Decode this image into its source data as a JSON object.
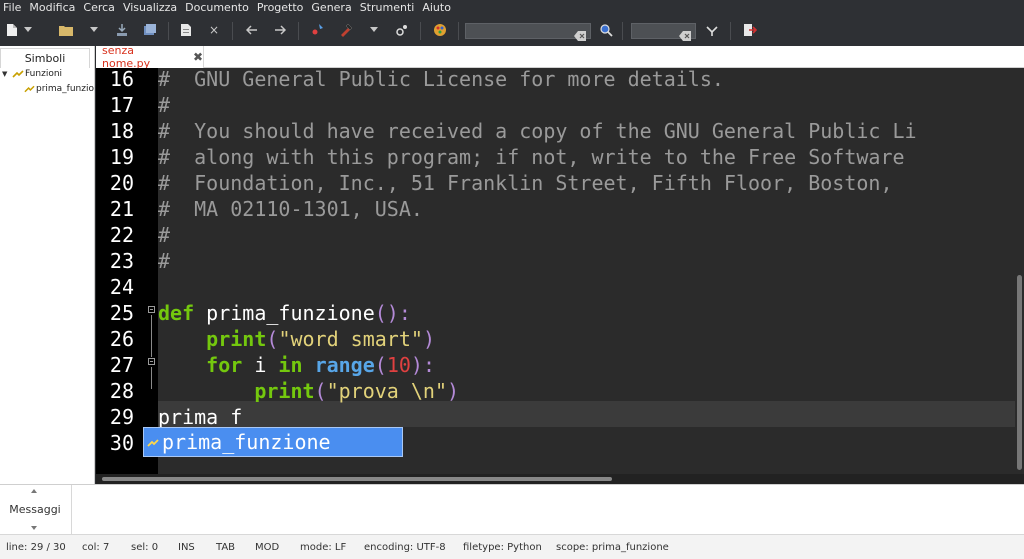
{
  "menubar": {
    "items": [
      "File",
      "Modifica",
      "Cerca",
      "Visualizza",
      "Documento",
      "Progetto",
      "Genera",
      "Strumenti",
      "Aiuto"
    ]
  },
  "toolbar": {
    "icons": [
      "new-file-icon",
      "dropdown-arrow-icon",
      "open-folder-icon",
      "dropdown-arrow-icon",
      "save-icon",
      "save-all-icon",
      "revert-icon",
      "close-icon",
      "back-icon",
      "forward-icon",
      "compile-icon",
      "build-icon",
      "dropdown-arrow-icon",
      "execute-icon",
      "color-picker-icon",
      "search-go-icon",
      "jump-to-line-icon",
      "quit-icon"
    ],
    "search_value": "",
    "goto_value": ""
  },
  "sidebar": {
    "tab_label": "Simboli",
    "tree": [
      {
        "label": "Funzioni",
        "level": 0,
        "expanded": true
      },
      {
        "label": "prima_funzio",
        "level": 1,
        "expanded": false
      }
    ]
  },
  "tabs": [
    {
      "title": "senza nome.py",
      "modified": true
    }
  ],
  "editor": {
    "lines": [
      {
        "n": "16",
        "tokens": [
          {
            "t": "cm",
            "v": "#  GNU General Public License for more details."
          }
        ]
      },
      {
        "n": "17",
        "tokens": [
          {
            "t": "cm",
            "v": "#"
          }
        ]
      },
      {
        "n": "18",
        "tokens": [
          {
            "t": "cm",
            "v": "#  You should have received a copy of the GNU General Public Li"
          }
        ]
      },
      {
        "n": "19",
        "tokens": [
          {
            "t": "cm",
            "v": "#  along with this program; if not, write to the Free Software"
          }
        ]
      },
      {
        "n": "20",
        "tokens": [
          {
            "t": "cm",
            "v": "#  Foundation, Inc., 51 Franklin Street, Fifth Floor, Boston,"
          }
        ]
      },
      {
        "n": "21",
        "tokens": [
          {
            "t": "cm",
            "v": "#  MA 02110-1301, USA."
          }
        ]
      },
      {
        "n": "22",
        "tokens": [
          {
            "t": "cm",
            "v": "#"
          }
        ]
      },
      {
        "n": "23",
        "tokens": [
          {
            "t": "cm",
            "v": "#"
          }
        ]
      },
      {
        "n": "24",
        "tokens": []
      },
      {
        "n": "25",
        "tokens": [
          {
            "t": "kw",
            "v": "def"
          },
          {
            "t": "nm",
            "v": " prima_funzione"
          },
          {
            "t": "pr",
            "v": "():"
          }
        ]
      },
      {
        "n": "26",
        "tokens": [
          {
            "t": "nm",
            "v": "    "
          },
          {
            "t": "kw",
            "v": "print"
          },
          {
            "t": "pr",
            "v": "("
          },
          {
            "t": "st",
            "v": "\"word smart\""
          },
          {
            "t": "pr",
            "v": ")"
          }
        ]
      },
      {
        "n": "27",
        "tokens": [
          {
            "t": "nm",
            "v": "    "
          },
          {
            "t": "kw",
            "v": "for"
          },
          {
            "t": "nm",
            "v": " i "
          },
          {
            "t": "kw",
            "v": "in"
          },
          {
            "t": "nm",
            "v": " "
          },
          {
            "t": "bi",
            "v": "range"
          },
          {
            "t": "pr",
            "v": "("
          },
          {
            "t": "num",
            "v": "10"
          },
          {
            "t": "pr",
            "v": "):"
          }
        ]
      },
      {
        "n": "28",
        "tokens": [
          {
            "t": "nm",
            "v": "        "
          },
          {
            "t": "kw",
            "v": "print"
          },
          {
            "t": "pr",
            "v": "("
          },
          {
            "t": "st",
            "v": "\"prova \\n\""
          },
          {
            "t": "pr",
            "v": ")"
          }
        ]
      },
      {
        "n": "29",
        "tokens": [
          {
            "t": "nm",
            "v": "prima_f"
          }
        ]
      },
      {
        "n": "30",
        "tokens": []
      }
    ]
  },
  "autocomplete": {
    "items": [
      "prima_funzione"
    ]
  },
  "messages": {
    "label": "Messaggi"
  },
  "statusbar": {
    "items": [
      "line: 29 / 30",
      "col: 7",
      "sel: 0",
      "INS",
      "TAB",
      "MOD",
      "mode: LF",
      "encoding: UTF-8",
      "filetype: Python",
      "scope: prima_funzione"
    ]
  }
}
